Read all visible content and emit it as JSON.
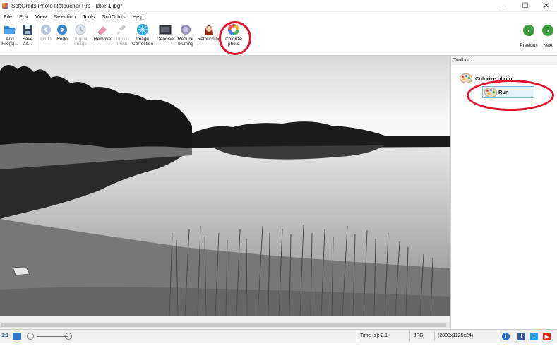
{
  "window": {
    "title": "SoftOrbits Photo Retoucher Pro - lake-1.jpg*",
    "minimize": "–",
    "maximize": "☐",
    "close": "✕"
  },
  "menu": [
    "File",
    "Edit",
    "View",
    "Selection",
    "Tools",
    "SoftOrbits",
    "Help"
  ],
  "toolbar": {
    "add_files": "Add\nFile(s)...",
    "save_as": "Save\nas...",
    "undo": "Undo",
    "redo": "Redo",
    "original_image": "Original\nImage",
    "remove": "Remove",
    "undo_brush": "Undo\nBrush",
    "image_correction": "Image\nCorrection",
    "denoise": "Denoise",
    "reduce_blurring": "Reduce\nblurring",
    "retouching": "Retouching",
    "colorize_photo": "Colorize\nphoto",
    "previous": "Previous",
    "next": "Next"
  },
  "toolbox": {
    "header": "Toolbox",
    "tool_title": "Colorize photo",
    "run_label": "Run"
  },
  "statusbar": {
    "zoom_label": "1:1",
    "time": "Time (s): 2.1",
    "format": "JPG",
    "dimensions": "(2000x1125x24)"
  },
  "colors": {
    "highlight_circle": "#e3112b",
    "nav_green": "#3c9b3c",
    "run_button_bg": "#e5f1fb"
  },
  "icons": {
    "info": "info-icon",
    "facebook": "facebook-icon",
    "twitter": "twitter-icon",
    "youtube": "youtube-icon"
  }
}
